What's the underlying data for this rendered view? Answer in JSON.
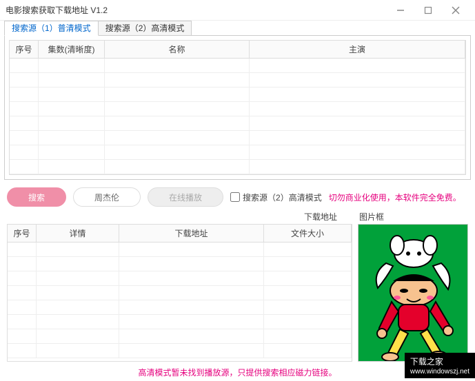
{
  "window": {
    "title": "电影搜索获取下载地址 V1.2"
  },
  "tabs": [
    {
      "label": "搜索源（1）普清模式"
    },
    {
      "label": "搜索源（2）高清模式"
    }
  ],
  "grid1": {
    "cols": {
      "c1": "序号",
      "c2": "集数(清晰度)",
      "c3": "名称",
      "c4": "主演"
    }
  },
  "controls": {
    "search": "搜索",
    "keyword_placeholder": "周杰伦",
    "play": "在线播放",
    "hd_label": "搜索源（2）高清模式",
    "warn": "切勿商业化使用，本软件完全免费。"
  },
  "sections": {
    "download": "下载地址",
    "image": "图片框"
  },
  "grid2": {
    "cols": {
      "d1": "序号",
      "d2": "详情",
      "d3": "下载地址",
      "d4": "文件大小"
    }
  },
  "footer": "高清模式暂未找到播放源，只提供搜索相应磁力链接。",
  "watermark": {
    "zh": "下载之家",
    "en": "www.windowszj.net"
  }
}
